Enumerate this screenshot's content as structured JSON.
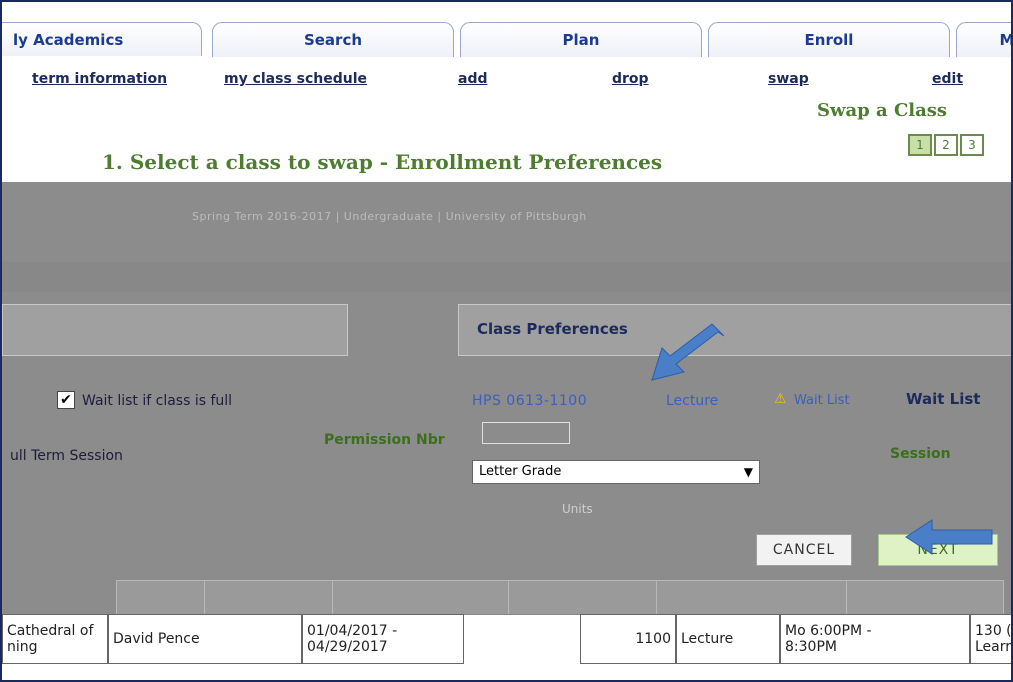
{
  "top_tabs": [
    "ly Academics",
    "Search",
    "Plan",
    "Enroll",
    "M"
  ],
  "sub_tabs": [
    "term information",
    "my class schedule",
    "add",
    "drop",
    "swap",
    "edit"
  ],
  "page_heading": "Swap a Class",
  "step_title": "1.  Select a class to swap - Enrollment Preferences",
  "steps": [
    "1",
    "2",
    "3"
  ],
  "term_line": "Spring Term 2016-2017 | Undergraduate | University of Pittsburgh",
  "class_preferences_title": "Class Preferences",
  "wait_list_checkbox_label": "Wait list if class is full",
  "class_id": "HPS 0613-1100",
  "class_type": "Lecture",
  "wait_list_badge": "Wait List",
  "wait_list_label": "Wait List",
  "permission_label": "Permission Nbr",
  "session_left": "ull Term Session",
  "session_label": "Session",
  "grading_value": "Letter Grade",
  "units_label": "Units",
  "buttons": {
    "cancel": "CANCEL",
    "next": "NEXT"
  },
  "table_row": {
    "room": "Cathedral of ",
    "room_line2": "ning",
    "instructor": "David Pence",
    "dates_line1": "01/04/2017 -",
    "dates_line2": "04/29/2017",
    "class_nbr": "1100",
    "component": "Lecture",
    "days_line1": "Mo 6:00PM -",
    "days_line2": "8:30PM",
    "loc_line1": "130 (",
    "loc_line2": "Learr"
  },
  "colors": {
    "accent_green": "#4e7d32",
    "nav_blue": "#1d3c8f",
    "arrow_blue": "#4a7fc8"
  }
}
